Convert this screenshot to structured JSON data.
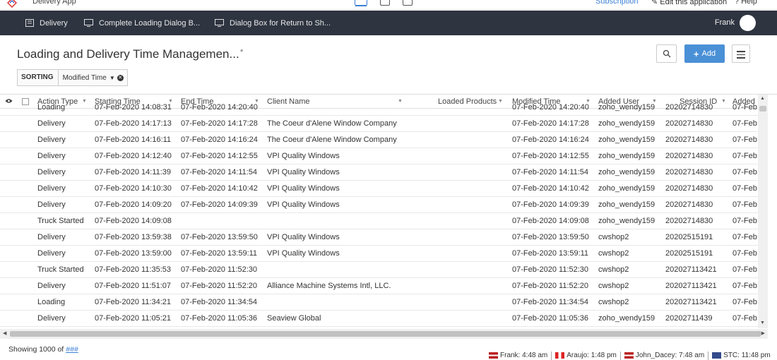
{
  "app": {
    "name": "Delivery App",
    "subscription": "Subscription",
    "edit": "Edit this application",
    "help": "Help"
  },
  "nav": {
    "items": [
      {
        "label": "Delivery"
      },
      {
        "label": "Complete Loading Dialog B..."
      },
      {
        "label": "Dialog Box for Return to Sh..."
      }
    ],
    "user": "Frank"
  },
  "page": {
    "title": "Loading and Delivery Time Managemen...",
    "star": "*",
    "add_label": "Add"
  },
  "sorting": {
    "label": "SORTING",
    "value": "Modified Time"
  },
  "table": {
    "columns": [
      "Action Type",
      "Starting Time",
      "End Time",
      "Client Name",
      "Loaded Products",
      "Modified Time",
      "Added User",
      "Session ID",
      "Added"
    ],
    "partial_row": [
      "Loading",
      "07-Feb-2020 14:08:31",
      "07-Feb-2020 14:20:40",
      "",
      "",
      "07-Feb-2020 14:20:40",
      "zoho_wendy159",
      "20202714830",
      "07-Feb"
    ],
    "rows": [
      [
        "Delivery",
        "07-Feb-2020 14:17:13",
        "07-Feb-2020 14:17:28",
        "The Coeur d'Alene Window Company",
        "",
        "07-Feb-2020 14:17:28",
        "zoho_wendy159",
        "20202714830",
        "07-Feb"
      ],
      [
        "Delivery",
        "07-Feb-2020 14:16:11",
        "07-Feb-2020 14:16:24",
        "The Coeur d'Alene Window Company",
        "",
        "07-Feb-2020 14:16:24",
        "zoho_wendy159",
        "20202714830",
        "07-Feb"
      ],
      [
        "Delivery",
        "07-Feb-2020 14:12:40",
        "07-Feb-2020 14:12:55",
        "VPI Quality Windows",
        "",
        "07-Feb-2020 14:12:55",
        "zoho_wendy159",
        "20202714830",
        "07-Feb"
      ],
      [
        "Delivery",
        "07-Feb-2020 14:11:39",
        "07-Feb-2020 14:11:54",
        "VPI Quality Windows",
        "",
        "07-Feb-2020 14:11:54",
        "zoho_wendy159",
        "20202714830",
        "07-Feb"
      ],
      [
        "Delivery",
        "07-Feb-2020 14:10:30",
        "07-Feb-2020 14:10:42",
        "VPI Quality Windows",
        "",
        "07-Feb-2020 14:10:42",
        "zoho_wendy159",
        "20202714830",
        "07-Feb"
      ],
      [
        "Delivery",
        "07-Feb-2020 14:09:20",
        "07-Feb-2020 14:09:39",
        "VPI Quality Windows",
        "",
        "07-Feb-2020 14:09:39",
        "zoho_wendy159",
        "20202714830",
        "07-Feb"
      ],
      [
        "Truck Started",
        "07-Feb-2020 14:09:08",
        "",
        "",
        "",
        "07-Feb-2020 14:09:08",
        "zoho_wendy159",
        "20202714830",
        "07-Feb"
      ],
      [
        "Delivery",
        "07-Feb-2020 13:59:38",
        "07-Feb-2020 13:59:50",
        "VPI Quality Windows",
        "",
        "07-Feb-2020 13:59:50",
        "cwshop2",
        "20202515191",
        "07-Feb"
      ],
      [
        "Delivery",
        "07-Feb-2020 13:59:00",
        "07-Feb-2020 13:59:11",
        "VPI Quality Windows",
        "",
        "07-Feb-2020 13:59:11",
        "cwshop2",
        "20202515191",
        "07-Feb"
      ],
      [
        "Truck Started",
        "07-Feb-2020 11:35:53",
        "07-Feb-2020 11:52:30",
        "",
        "",
        "07-Feb-2020 11:52:30",
        "cwshop2",
        "202027113421",
        "07-Feb"
      ],
      [
        "Delivery",
        "07-Feb-2020 11:51:07",
        "07-Feb-2020 11:52:20",
        "Alliance Machine Systems Intl, LLC.",
        "",
        "07-Feb-2020 11:52:20",
        "cwshop2",
        "202027113421",
        "07-Feb"
      ],
      [
        "Loading",
        "07-Feb-2020 11:34:21",
        "07-Feb-2020 11:34:54",
        "",
        "",
        "07-Feb-2020 11:34:54",
        "cwshop2",
        "202027113421",
        "07-Feb"
      ],
      [
        "Delivery",
        "07-Feb-2020 11:05:21",
        "07-Feb-2020 11:05:36",
        "Seaview Global",
        "",
        "07-Feb-2020 11:05:36",
        "zoho_wendy159",
        "20202711439",
        "07-Feb"
      ]
    ]
  },
  "footer": {
    "showing": "Showing 1000 of",
    "total": "###"
  },
  "clocks": [
    {
      "label": "Frank: 4:48 am"
    },
    {
      "label": "Araujo: 1:48 pm"
    },
    {
      "label": "John_Dacey: 7:48 am"
    },
    {
      "label": "STC: 11:48 pm"
    }
  ],
  "colors": {
    "navbar": "#2e3440",
    "accent": "#4a90d6",
    "link": "#3a7fd5"
  }
}
